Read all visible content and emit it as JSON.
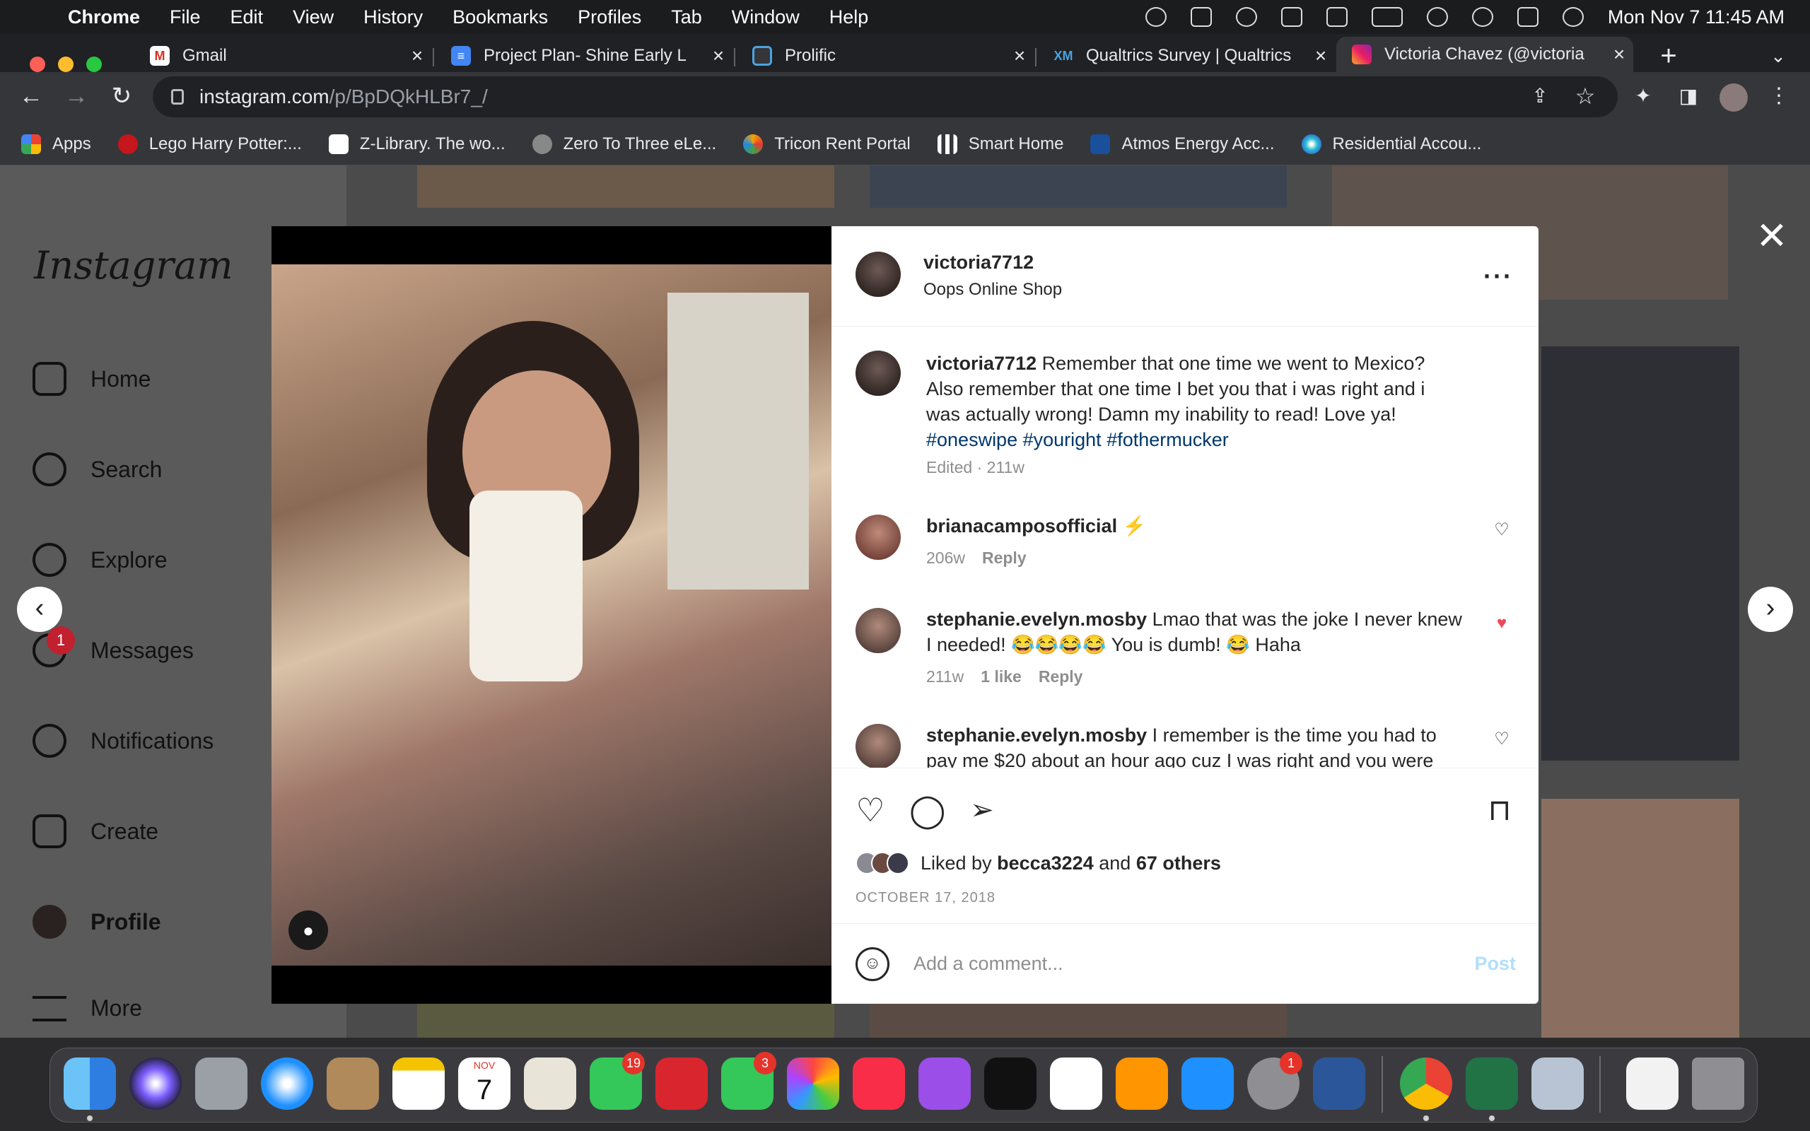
{
  "menubar": {
    "items": [
      "Chrome",
      "File",
      "Edit",
      "View",
      "History",
      "Bookmarks",
      "Profiles",
      "Tab",
      "Window",
      "Help"
    ],
    "clock": "Mon Nov 7  11:45 AM"
  },
  "tabs": [
    {
      "title": "Gmail",
      "icon": "gmail-icon"
    },
    {
      "title": "Project Plan- Shine Early L",
      "icon": "docs-icon"
    },
    {
      "title": "Prolific",
      "icon": "prolific-icon"
    },
    {
      "title": "Qualtrics Survey | Qualtrics",
      "icon": "qualtrics-icon"
    },
    {
      "title": "Victoria Chavez (@victoria",
      "icon": "instagram-icon"
    }
  ],
  "address": {
    "domain": "instagram.com",
    "path": "/p/BpDQkHLBr7_/"
  },
  "bookmarks": [
    {
      "label": "Apps",
      "color": "#4285f4"
    },
    {
      "label": "Lego Harry Potter:...",
      "color": "#c4161c"
    },
    {
      "label": "Z-Library. The wo...",
      "color": "#ffffff"
    },
    {
      "label": "Zero To Three eLe...",
      "color": "#888888"
    },
    {
      "label": "Tricon Rent Portal",
      "color": "#f4a300"
    },
    {
      "label": "Smart Home",
      "color": "#ffffff"
    },
    {
      "label": "Atmos Energy Acc...",
      "color": "#1a4f9c"
    },
    {
      "label": "Residential Accou...",
      "color": "#30c0d0"
    }
  ],
  "instagram": {
    "logo": "Instagram",
    "nav": [
      {
        "label": "Home",
        "icon": "home-icon"
      },
      {
        "label": "Search",
        "icon": "search-icon"
      },
      {
        "label": "Explore",
        "icon": "compass-icon"
      },
      {
        "label": "Messages",
        "icon": "messenger-icon"
      },
      {
        "label": "Notifications",
        "icon": "heart-icon"
      },
      {
        "label": "Create",
        "icon": "plus-square-icon"
      },
      {
        "label": "Profile",
        "icon": "profile-avatar"
      },
      {
        "label": "More",
        "icon": "menu-icon"
      }
    ],
    "messages_badge": "1"
  },
  "post": {
    "username": "victoria7712",
    "location": "Oops Online Shop",
    "caption_user": "victoria7712",
    "caption": "Remember that one time we went to Mexico? Also remember that one time I bet you that i was right and i was actually wrong! Damn my inability to read! Love ya!",
    "hashtags": [
      "#oneswipe",
      "#youright",
      "#fothermucker"
    ],
    "caption_meta": "Edited · 211w",
    "comments": [
      {
        "user": "brianacamposofficial",
        "text": "⚡",
        "age": "206w",
        "likes": "",
        "reply": "Reply",
        "liked": false
      },
      {
        "user": "stephanie.evelyn.mosby",
        "text": "Lmao that was the joke I never knew I needed! 😂😂😂😂 You is dumb! 😂 Haha",
        "age": "211w",
        "likes": "1 like",
        "reply": "Reply",
        "liked": true
      },
      {
        "user": "stephanie.evelyn.mosby",
        "text": "I remember is the time you had to pay me $20 about an hour ago cuz I was right and you were",
        "age": "",
        "likes": "",
        "reply": "",
        "liked": false
      }
    ],
    "liked_by_prefix": "Liked by",
    "liked_by_user": "becca3224",
    "liked_by_and": "and",
    "liked_by_others": "67 others",
    "date": "OCTOBER 17, 2018",
    "comment_placeholder": "Add a comment...",
    "post_button": "Post"
  },
  "dock": {
    "badges": {
      "messages": "19",
      "photo_booth": "",
      "facetime": "3",
      "system_prefs": "1"
    },
    "calendar_month": "NOV",
    "calendar_day": "7"
  }
}
